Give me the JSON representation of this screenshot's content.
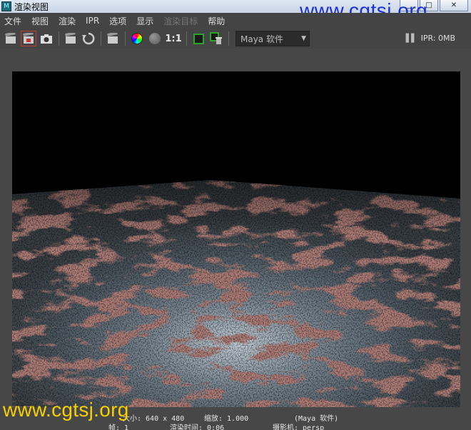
{
  "window": {
    "title": "渲染视图",
    "minimize": "_",
    "maximize": "□",
    "close": "✕"
  },
  "watermark": {
    "top": "www.cgtsj.org",
    "bottom": "www.cgtsj.org"
  },
  "menu": {
    "items": [
      "文件",
      "视图",
      "渲染",
      "IPR",
      "选项",
      "显示",
      "渲染目标",
      "帮助"
    ]
  },
  "toolbar": {
    "ratio_label": "1:1",
    "renderer": "Maya 软件",
    "ipr_status": "IPR: 0MB"
  },
  "status": {
    "size": "大小: 640 x 480",
    "zoom": "缩放: 1.000",
    "renderer": "(Maya 软件)",
    "frame": "帧: 1",
    "render_time": "渲染时间: 0:06",
    "camera": "摄影机: persp"
  }
}
